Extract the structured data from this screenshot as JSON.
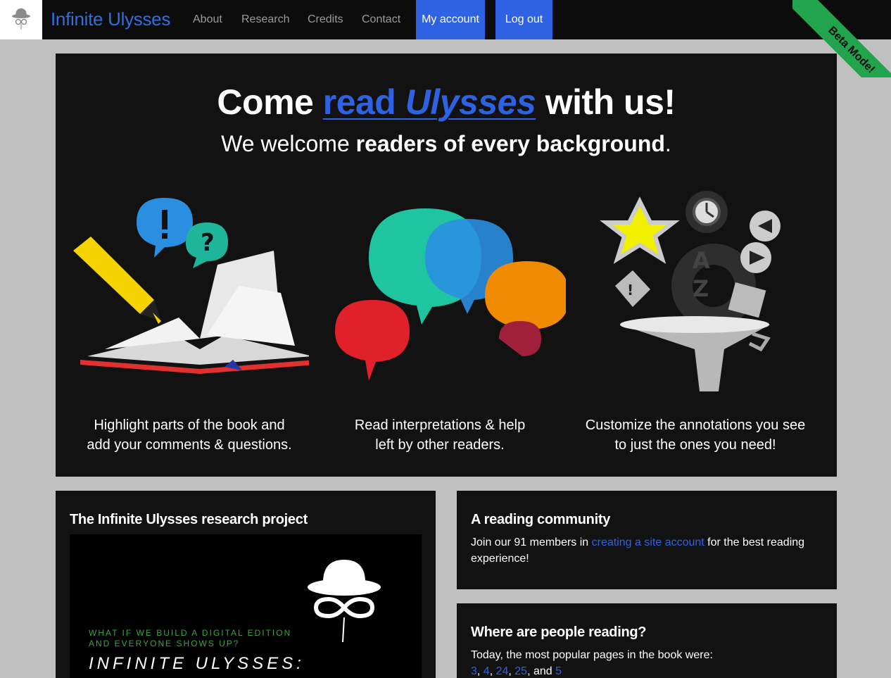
{
  "nav": {
    "brand": "Infinite Ulysses",
    "links": [
      "About",
      "Research",
      "Credits",
      "Contact"
    ],
    "my_account": "My account",
    "log_out": "Log out",
    "ribbon": "Beta Mode!"
  },
  "hero": {
    "title_pre": "Come ",
    "title_link_a": "read ",
    "title_link_b": "Ulysses",
    "title_post": " with us!",
    "sub_pre": "We welcome ",
    "sub_bold": "readers of every background",
    "sub_post": ".",
    "features": [
      {
        "caption_1": "Highlight parts of the book and",
        "caption_2": "add your comments & questions."
      },
      {
        "caption_1": "Read interpretations & help",
        "caption_2": "left by other readers."
      },
      {
        "caption_1": "Customize the annotations you see",
        "caption_2": "to just the ones you need!"
      }
    ]
  },
  "research": {
    "title": "The Infinite Ulysses research project",
    "video_tag_1": "WHAT IF WE BUILD A DIGITAL EDITION",
    "video_tag_2": "AND EVERYONE SHOWS UP?",
    "video_title": "INFINITE ULYSSES:"
  },
  "community": {
    "title": "A reading community",
    "text_pre": "Join our 91 members in ",
    "link": "creating a site account",
    "text_post": " for the best reading experience!"
  },
  "popular": {
    "title": "Where are people reading?",
    "text": "Today, the most popular pages in the book were:",
    "pages": [
      "3",
      "4",
      "24",
      "25",
      "5"
    ],
    "and": "and"
  },
  "colors": {
    "accent": "#2f62e2",
    "brand": "#2f6fe0",
    "ribbon": "#22a34d",
    "background": "#c0c0c0",
    "panel": "#121212"
  }
}
